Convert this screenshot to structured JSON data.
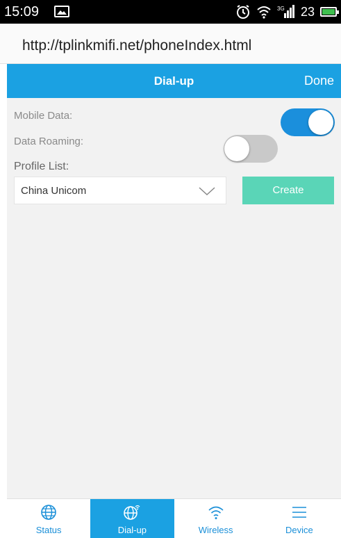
{
  "status_bar": {
    "time": "15:09",
    "signal_label": "3G",
    "battery_level": "23"
  },
  "browser": {
    "url": "http://tplinkmifi.net/phoneIndex.html"
  },
  "header": {
    "title": "Dial-up",
    "done_label": "Done"
  },
  "settings": {
    "mobile_data_label": "Mobile Data:",
    "mobile_data_on": true,
    "data_roaming_label": "Data Roaming:",
    "data_roaming_on": false,
    "profile_list_label": "Profile List:",
    "profile_selected": "China Unicom",
    "create_label": "Create"
  },
  "bottom_nav": {
    "items": [
      {
        "label": "Status",
        "icon": "globe-icon",
        "active": false
      },
      {
        "label": "Dial-up",
        "icon": "globe-signal-icon",
        "active": true
      },
      {
        "label": "Wireless",
        "icon": "wifi-icon",
        "active": false
      },
      {
        "label": "Device",
        "icon": "menu-icon",
        "active": false
      }
    ]
  },
  "colors": {
    "accent": "#1ba1e2",
    "toggle_on": "#1b8fdc",
    "toggle_off": "#c9c9c9",
    "create_button": "#5ad5b7",
    "content_bg": "#f2f2f2"
  }
}
